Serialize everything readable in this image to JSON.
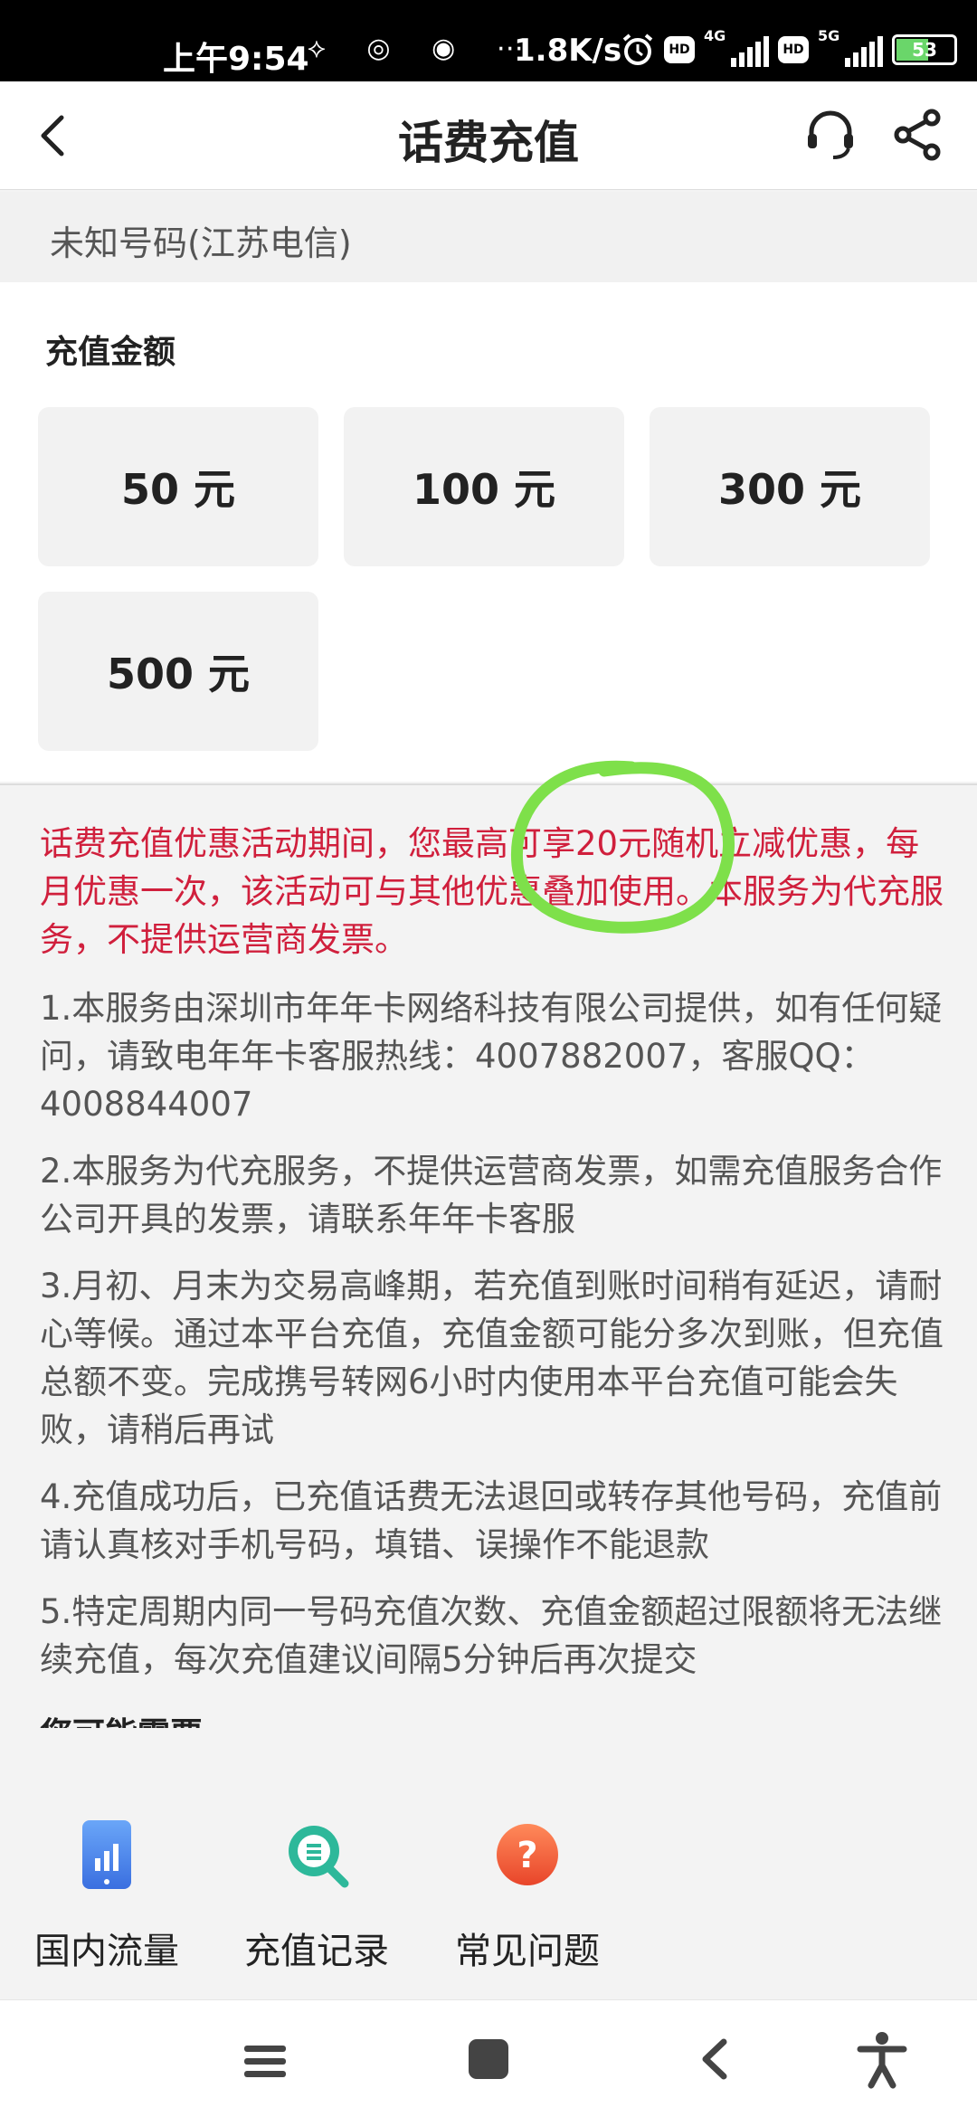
{
  "status_bar": {
    "time": "上午9:54",
    "icons_left": "⟡ ◎ ◉ ⋯",
    "speed": "1.8K/s",
    "hd": "HD",
    "net1": "4G",
    "net2": "5G",
    "battery": "53",
    "battery_level": 0.53
  },
  "header": {
    "title": "话费充值"
  },
  "phone": {
    "label": "未知号码(江苏电信)"
  },
  "amount": {
    "title": "充值金额",
    "options": [
      "50 元",
      "100 元",
      "300 元",
      "500 元"
    ]
  },
  "notice": {
    "promo": "话费充值优惠活动期间，您最高可享20元随机立减优惠，每月优惠一次，该活动可与其他优惠叠加使用。本服务为代充服务，不提供运营商发票。",
    "rules": [
      "1.本服务由深圳市年年卡网络科技有限公司提供，如有任何疑问，请致电年年卡客服热线：4007882007，客服QQ：4008844007",
      "2.本服务为代充服务，不提供运营商发票，如需充值服务合作公司开具的发票，请联系年年卡客服",
      "3.月初、月末为交易高峰期，若充值到账时间稍有延迟，请耐心等候。通过本平台充值，充值金额可能分多次到账，但充值总额不变。完成携号转网6小时内使用本平台充值可能会失败，请稍后再试",
      "4.充值成功后，已充值话费无法退回或转存其他号码，充值前请认真核对手机号码，填错、误操作不能退款",
      "5.特定周期内同一号码充值次数、充值金额超过限额将无法继续充值，每次充值建议间隔5分钟后再次提交"
    ],
    "needs_title": "您可能需要"
  },
  "quick_links": [
    {
      "label": "国内流量",
      "icon": "data-usage-icon"
    },
    {
      "label": "充值记录",
      "icon": "record-search-icon"
    },
    {
      "label": "常见问题",
      "icon": "question-icon"
    }
  ],
  "colors": {
    "promo_red": "#d01f3c",
    "highlight_green": "#7ee04a"
  }
}
